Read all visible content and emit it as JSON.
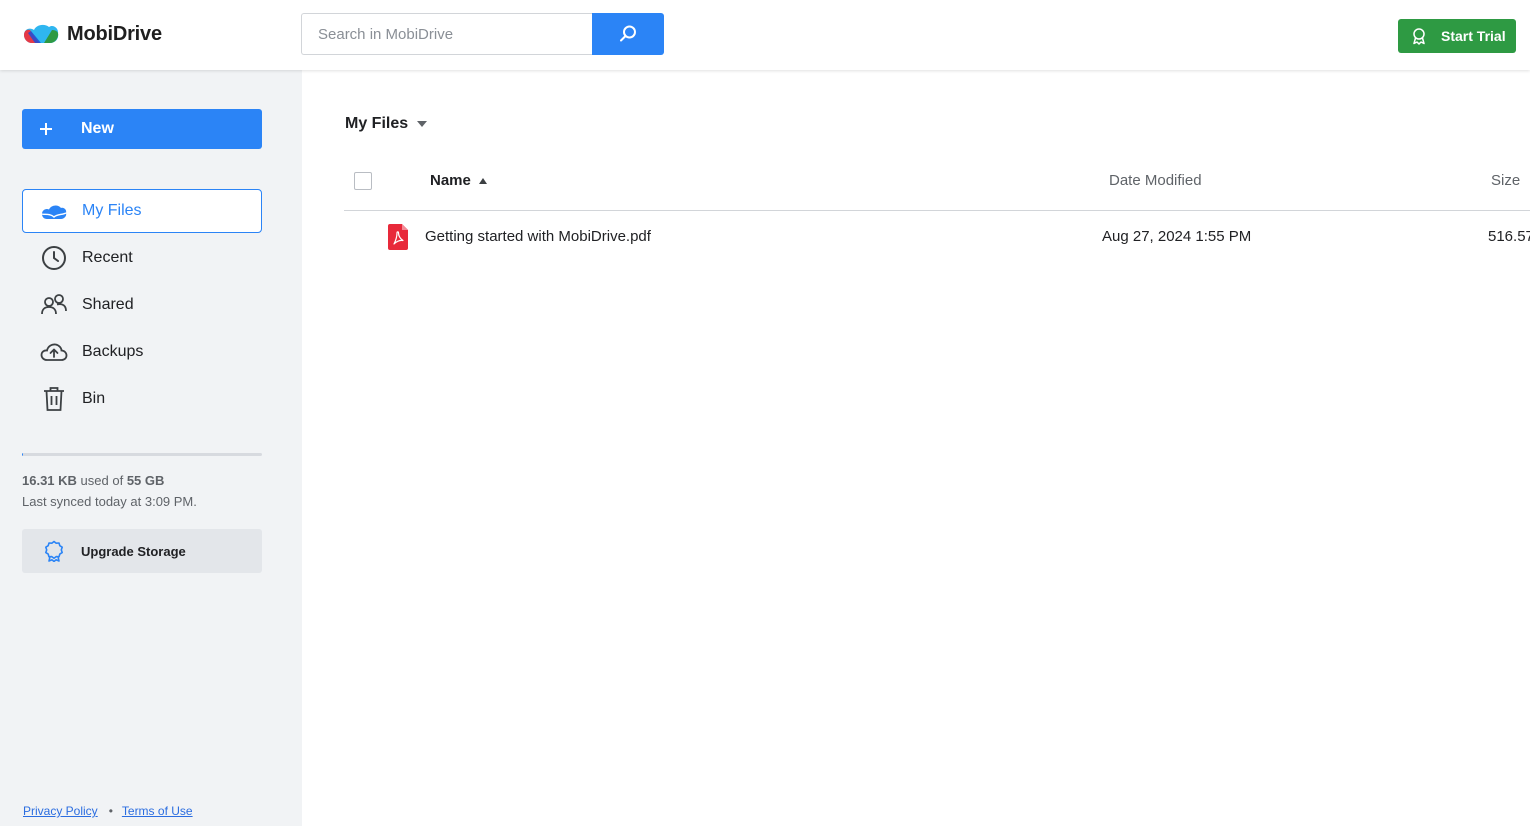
{
  "app": {
    "name": "MobiDrive"
  },
  "header": {
    "search_placeholder": "Search in MobiDrive",
    "start_trial_label": "Start Trial"
  },
  "sidebar": {
    "new_label": "New",
    "items": [
      {
        "label": "My Files",
        "icon": "cloud-icon",
        "active": true
      },
      {
        "label": "Recent",
        "icon": "clock-icon",
        "active": false
      },
      {
        "label": "Shared",
        "icon": "people-icon",
        "active": false
      },
      {
        "label": "Backups",
        "icon": "cloud-upload-icon",
        "active": false
      },
      {
        "label": "Bin",
        "icon": "trash-icon",
        "active": false
      }
    ],
    "storage": {
      "used": "16.31 KB",
      "used_of": "used of",
      "total": "55 GB",
      "used_fraction": 0.0003,
      "synced": "Last synced today at 3:09 PM."
    },
    "upgrade_label": "Upgrade Storage",
    "footer": {
      "privacy": "Privacy Policy",
      "terms": "Terms of Use"
    }
  },
  "main": {
    "breadcrumb": "My Files",
    "columns": {
      "name": "Name",
      "date": "Date Modified",
      "size": "Size"
    },
    "files": [
      {
        "name": "Getting started with MobiDrive.pdf",
        "date": "Aug 27, 2024 1:55 PM",
        "size": "516.57",
        "type": "pdf"
      }
    ]
  },
  "colors": {
    "accent": "#2b84f6",
    "trial": "#2e9a43",
    "pdf": "#e8293a",
    "sidebar_bg": "#f1f3f5"
  }
}
